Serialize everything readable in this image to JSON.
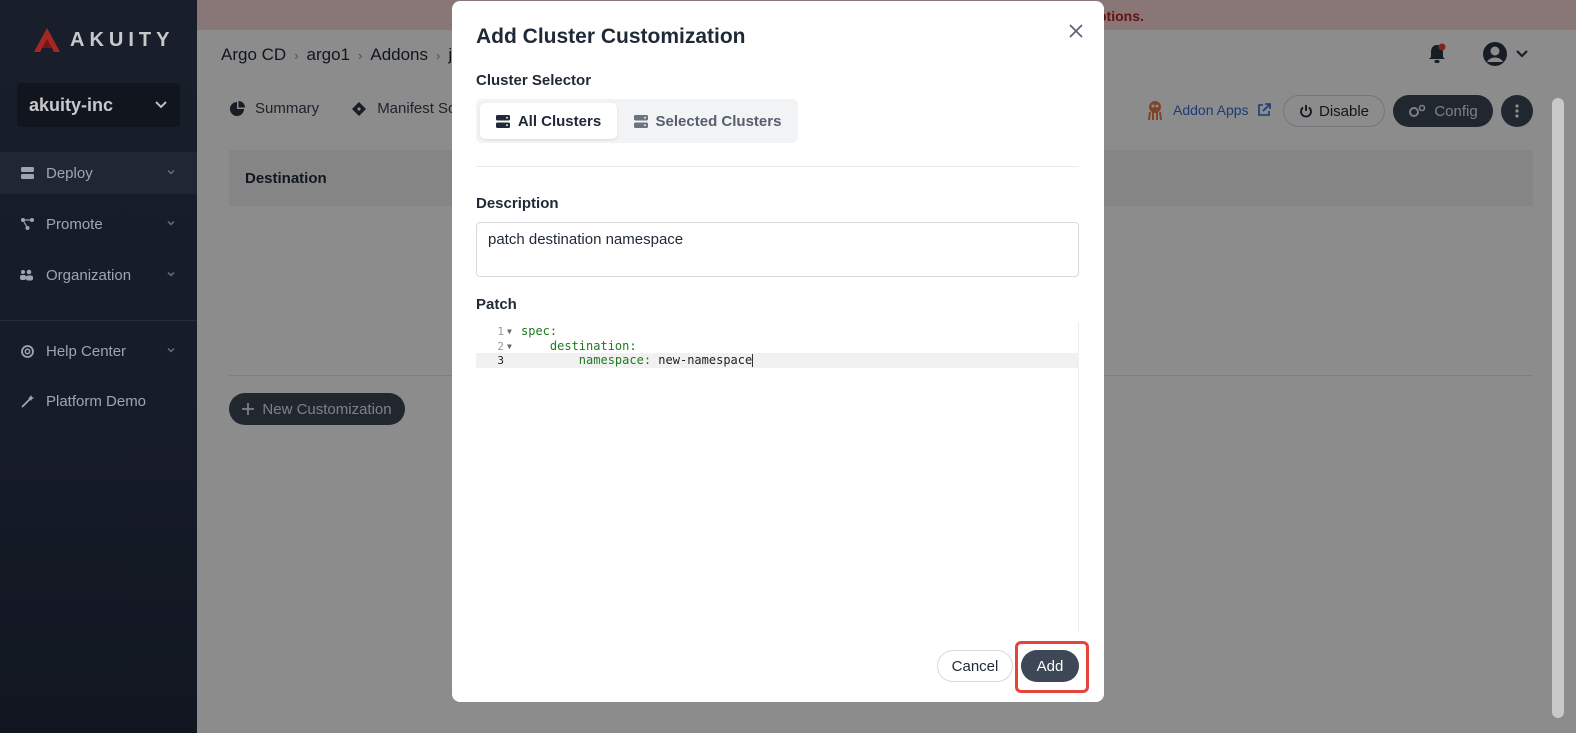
{
  "brand": {
    "name": "AKUITY",
    "accent": "#e5443a"
  },
  "sidebar": {
    "org": "akuity-inc",
    "items": [
      {
        "label": "Deploy",
        "icon": "server-icon"
      },
      {
        "label": "Promote",
        "icon": "share-icon"
      },
      {
        "label": "Organization",
        "icon": "users-icon"
      },
      {
        "label": "Help Center",
        "icon": "lifebuoy-icon"
      },
      {
        "label": "Platform Demo",
        "icon": "wand-icon"
      }
    ]
  },
  "banner": {
    "text": "ptions."
  },
  "breadcrumb": [
    "Argo CD",
    "argo1",
    "Addons",
    "j"
  ],
  "tabs": [
    {
      "label": "Summary",
      "icon": "pie-chart-icon"
    },
    {
      "label": "Manifest So",
      "icon": "git-icon"
    }
  ],
  "actions": {
    "addon_apps": "Addon Apps",
    "disable": "Disable",
    "config": "Config"
  },
  "table": {
    "header": "Destination"
  },
  "new_customization": "New Customization",
  "modal": {
    "title": "Add Cluster Customization",
    "cluster_selector_label": "Cluster Selector",
    "options": [
      "All Clusters",
      "Selected Clusters"
    ],
    "selected_option": "All Clusters",
    "description_label": "Description",
    "description_value": "patch destination namespace",
    "patch_label": "Patch",
    "patch_lines": [
      {
        "num": "1",
        "key": "spec",
        "value": ""
      },
      {
        "num": "2",
        "key": "destination",
        "value": ""
      },
      {
        "num": "3",
        "key": "namespace",
        "value": "new-namespace"
      }
    ],
    "cancel": "Cancel",
    "add": "Add"
  }
}
